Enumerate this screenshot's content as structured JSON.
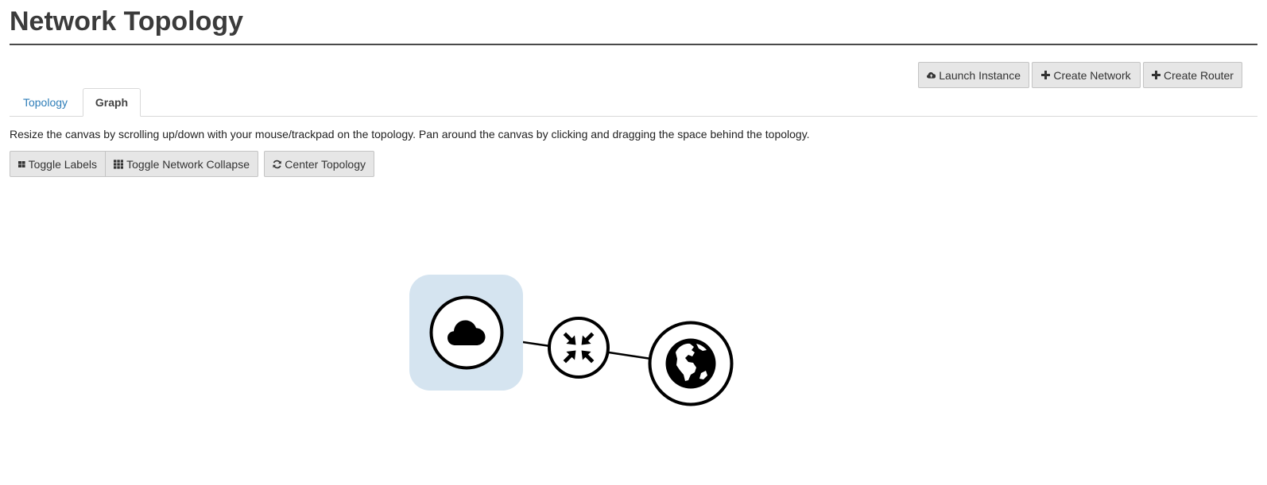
{
  "header": {
    "title": "Network Topology"
  },
  "actions": {
    "launch_instance": "Launch Instance",
    "create_network": "Create Network",
    "create_router": "Create Router"
  },
  "tabs": [
    {
      "label": "Topology",
      "active": false
    },
    {
      "label": "Graph",
      "active": true
    }
  ],
  "help_text": "Resize the canvas by scrolling up/down with your mouse/trackpad on the topology. Pan around the canvas by clicking and dragging the space behind the topology.",
  "toolbar": {
    "toggle_labels": "Toggle Labels",
    "toggle_network_collapse": "Toggle Network Collapse",
    "center_topology": "Center Topology"
  },
  "graph": {
    "nodes": [
      {
        "name": "network",
        "icon": "cloud-icon"
      },
      {
        "name": "router",
        "icon": "compress-arrows-icon"
      },
      {
        "name": "external-network",
        "icon": "globe-icon"
      }
    ],
    "colors": {
      "network_highlight": "#d5e4f0",
      "stroke": "#000000"
    }
  }
}
